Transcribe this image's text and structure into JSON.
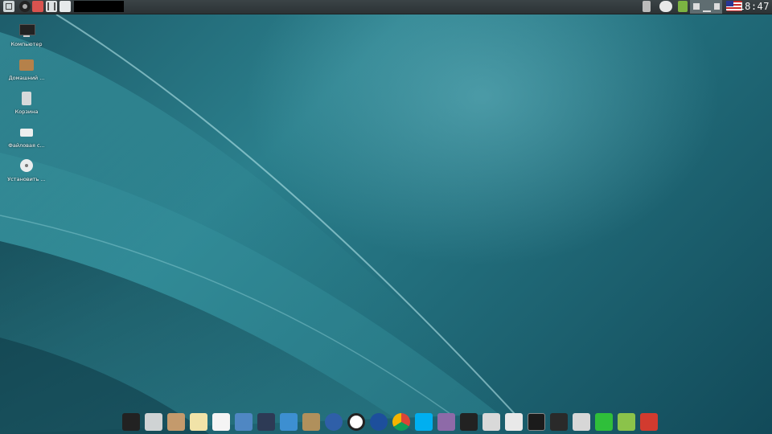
{
  "top_panel": {
    "clock": "18:47"
  },
  "desktop_icons": [
    {
      "label": "Компьютер",
      "icon": "computer-icon"
    },
    {
      "label": "Домашний ...",
      "icon": "home-folder-icon"
    },
    {
      "label": "Корзина",
      "icon": "trash-icon"
    },
    {
      "label": "Файловая с...",
      "icon": "filesystem-drive-icon"
    },
    {
      "label": "Установить ...",
      "icon": "install-disc-icon"
    }
  ],
  "dock_items": [
    "monitor-icon",
    "disk-utility-icon",
    "archive-icon",
    "text-editor-icon",
    "document-icon",
    "image-viewer-icon",
    "media-player-icon",
    "file-manager-icon",
    "gimp-icon",
    "network-globe-icon",
    "opera-icon",
    "firefox-icon",
    "chrome-icon",
    "skype-icon",
    "pidgin-icon",
    "tux-icon",
    "usb-writer-icon",
    "picture-icon",
    "terminal-icon",
    "system-monitor-icon",
    "settings-icon",
    "update-icon",
    "software-center-icon",
    "notes-icon"
  ],
  "colors": {
    "wallpaper": "#2b7f8c",
    "panel": "#353d40"
  }
}
